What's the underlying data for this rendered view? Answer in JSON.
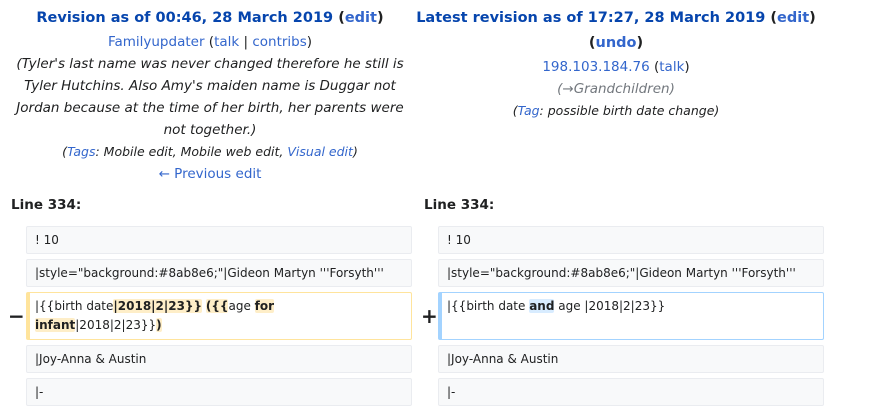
{
  "left": {
    "title_prefix": "Revision as of 00:46, 28 March 2019",
    "edit_link": "edit",
    "user": "Familyupdater",
    "talk": "talk",
    "contribs": "contribs",
    "summary_lines": [
      "(Tyler's last name was never changed therefore he still is",
      "Tyler Hutchins. Also Amy's maiden name is Duggar not",
      "Jordan because at the time of her birth, her parents were",
      "not together.)"
    ],
    "tags_link": "Tags",
    "tags_text": ": Mobile edit, Mobile web edit, ",
    "visual_edit": "Visual edit",
    "prev_edit": "← Previous edit",
    "line_label": "Line 334:"
  },
  "right": {
    "title_prefix": "Latest revision as of 17:27, 28 March 2019",
    "edit_link": "edit",
    "undo_link": "undo",
    "ip": "198.103.184.76",
    "talk": "talk",
    "section_arrow": "(→",
    "section_link": "Grandchildren",
    "section_close": ")",
    "tag_link": "Tag",
    "tag_text": ": possible birth date change)",
    "line_label": "Line 334:"
  },
  "diff": {
    "minus": "−",
    "plus": "+",
    "left_rows": [
      "! 10",
      "|style=\"background:#8ab8e6;\"|Gideon Martyn '''Forsyth'''",
      "",
      "|Joy-Anna & Austin",
      "|-"
    ],
    "right_rows": [
      "! 10",
      "|style=\"background:#8ab8e6;\"|Gideon Martyn '''Forsyth'''",
      "",
      "|Joy-Anna & Austin",
      "|-"
    ],
    "del_parts": {
      "a": "|{{birth date",
      "b": "|2018|2|23}}",
      "c": " ",
      "d": "({{",
      "e": "age ",
      "f": "for",
      "g": "infant",
      "h": "|2018|2|23}}",
      "i": ")"
    },
    "add_parts": {
      "a": "|{{birth date ",
      "b": "and",
      "c": " age |2018|2|23}}"
    }
  }
}
